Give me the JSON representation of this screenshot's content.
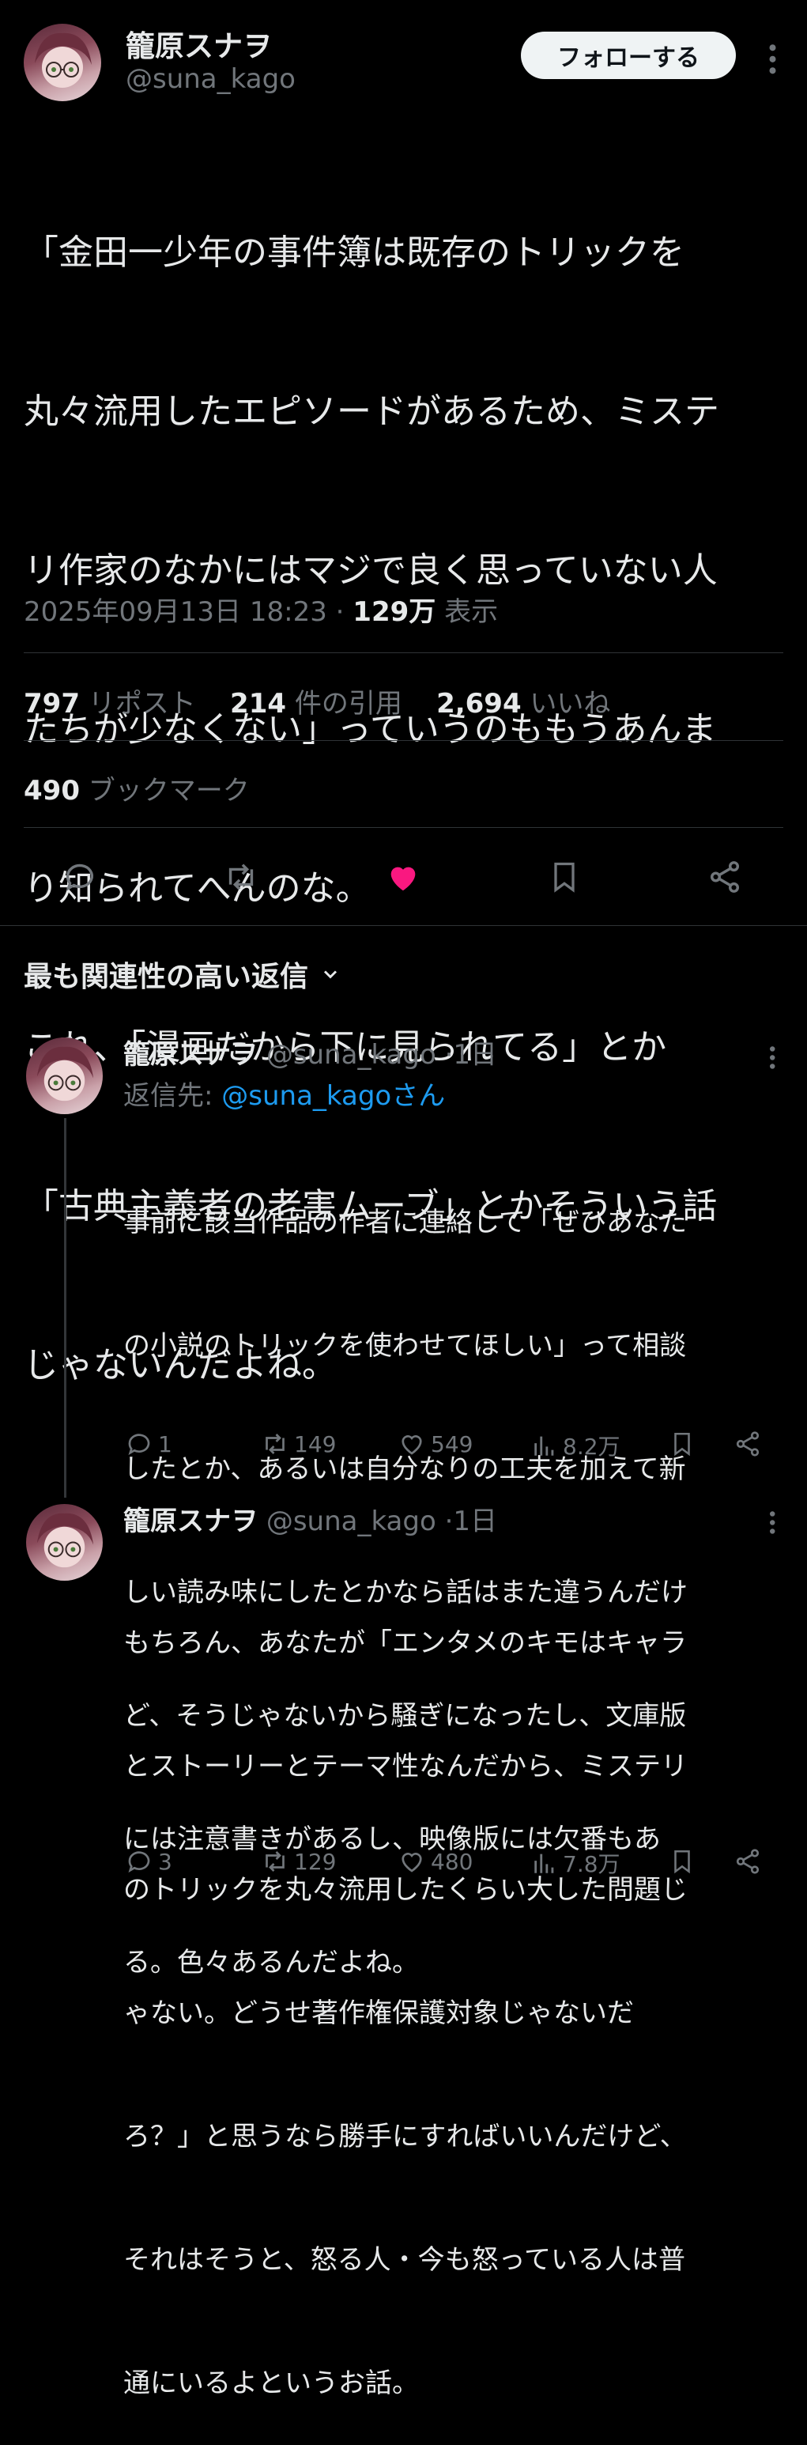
{
  "tweet": {
    "author_name": "籠原スナヲ",
    "author_handle": "@suna_kago",
    "follow_label": "フォローする",
    "text_lines": [
      "「金田一少年の事件簿は既存のトリックを",
      "丸々流用したエピソードがあるため、ミステ",
      "リ作家のなかにはマジで良く思っていない人",
      "たちが少なくない」っていうのももうあんま",
      "り知られてへんのな。",
      "これ、「漫画だから下に見られてる」とか",
      "「古典主義者の老害ムーブ」とかそういう話",
      "じゃないんだよね。"
    ],
    "timestamp": "2025年09月13日 18:23",
    "views_count": "129万",
    "views_label": "表示",
    "reposts_count": "797",
    "reposts_label": "リポスト",
    "quotes_count": "214",
    "quotes_label": "件の引用",
    "likes_count": "2,694",
    "likes_label": "いいね",
    "bookmarks_count": "490",
    "bookmarks_label": "ブックマーク"
  },
  "replies_header": {
    "label": "最も関連性の高い返信"
  },
  "replies": [
    {
      "author_name": "籠原スナヲ",
      "author_handle": "@suna_kago",
      "time": "1日",
      "replying_to_label": "返信先:",
      "replying_to_handle": "@suna_kagoさん",
      "text_lines": [
        "事前に該当作品の作者に連絡して「ぜひあなた",
        "の小説のトリックを使わせてほしい」って相談",
        "したとか、あるいは自分なりの工夫を加えて新",
        "しい読み味にしたとかなら話はまた違うんだけ",
        "ど、そうじゃないから騒ぎになったし、文庫版",
        "には注意書きがあるし、映像版には欠番もあ",
        "る。色々あるんだよね。"
      ],
      "replies": "1",
      "reposts": "149",
      "likes": "549",
      "views": "8.2万"
    },
    {
      "author_name": "籠原スナヲ",
      "author_handle": "@suna_kago",
      "time": "1日",
      "text_lines": [
        "もちろん、あなたが「エンタメのキモはキャラ",
        "とストーリーとテーマ性なんだから、ミステリ",
        "のトリックを丸々流用したくらい大した問題じ",
        "ゃない。どうせ著作権保護対象じゃないだ",
        "ろ？」と思うなら勝手にすればいいんだけど、",
        "それはそうと、怒る人・今も怒っている人は普",
        "通にいるよというお話。"
      ],
      "replies": "3",
      "reposts": "129",
      "likes": "480",
      "views": "7.8万"
    }
  ],
  "colors": {
    "background": "#000000",
    "text": "#e7e9ea",
    "muted": "#71767b",
    "link": "#1d9bf0",
    "like_active": "#f91880",
    "divider": "#2f3336"
  }
}
